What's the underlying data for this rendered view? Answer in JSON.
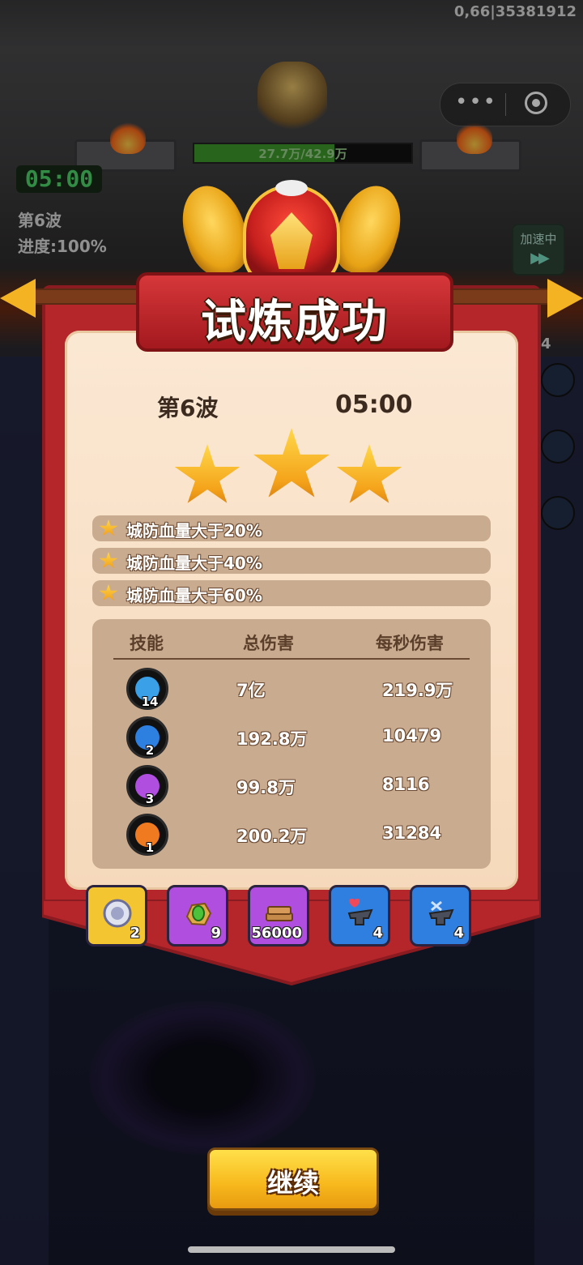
{
  "system": {
    "id_text": "0,66|35381912"
  },
  "hud": {
    "boss_hp_text": "27.7万/42.9万",
    "boss_hp_fraction": 0.646,
    "timer": "05:00",
    "wave": "第6波",
    "progress": "进度:100%",
    "speed_label": "加速中",
    "speed_icon": "fast-forward-icon",
    "side_badge": "4"
  },
  "result": {
    "title": "试炼成功",
    "wave": "第6波",
    "time": "05:00",
    "stars_earned": 3,
    "conditions": [
      {
        "text": "城防血量大于20%"
      },
      {
        "text": "城防血量大于40%"
      },
      {
        "text": "城防血量大于60%"
      }
    ],
    "table": {
      "headers": {
        "skill": "技能",
        "total": "总伤害",
        "dps": "每秒伤害"
      },
      "rows": [
        {
          "icon": "ice-shard-skill-icon",
          "color": "#3aa0e8",
          "level": "14",
          "total": "7亿",
          "dps": "219.9万"
        },
        {
          "icon": "lightning-beast-skill-icon",
          "color": "#2d7fe0",
          "level": "2",
          "total": "192.8万",
          "dps": "10479"
        },
        {
          "icon": "arcane-orb-skill-icon",
          "color": "#b04ee0",
          "level": "3",
          "total": "99.8万",
          "dps": "8116"
        },
        {
          "icon": "fireball-skill-icon",
          "color": "#f07a20",
          "level": "1",
          "total": "200.2万",
          "dps": "31284"
        }
      ]
    },
    "rewards": [
      {
        "icon": "silver-coin-icon",
        "frame": "#f2c531",
        "count": "2"
      },
      {
        "icon": "green-gem-ore-icon",
        "frame": "#b04ee0",
        "count": "9"
      },
      {
        "icon": "wood-planks-icon",
        "frame": "#b04ee0",
        "count": "56000"
      },
      {
        "icon": "heart-anvil-icon",
        "frame": "#2f7fe0",
        "count": "4"
      },
      {
        "icon": "sword-anvil-icon",
        "frame": "#2f7fe0",
        "count": "4"
      }
    ],
    "continue_label": "继续"
  },
  "colors": {
    "banner": "#b5262b",
    "parchment": "#fbe8d3",
    "button": "#f7b81c"
  }
}
